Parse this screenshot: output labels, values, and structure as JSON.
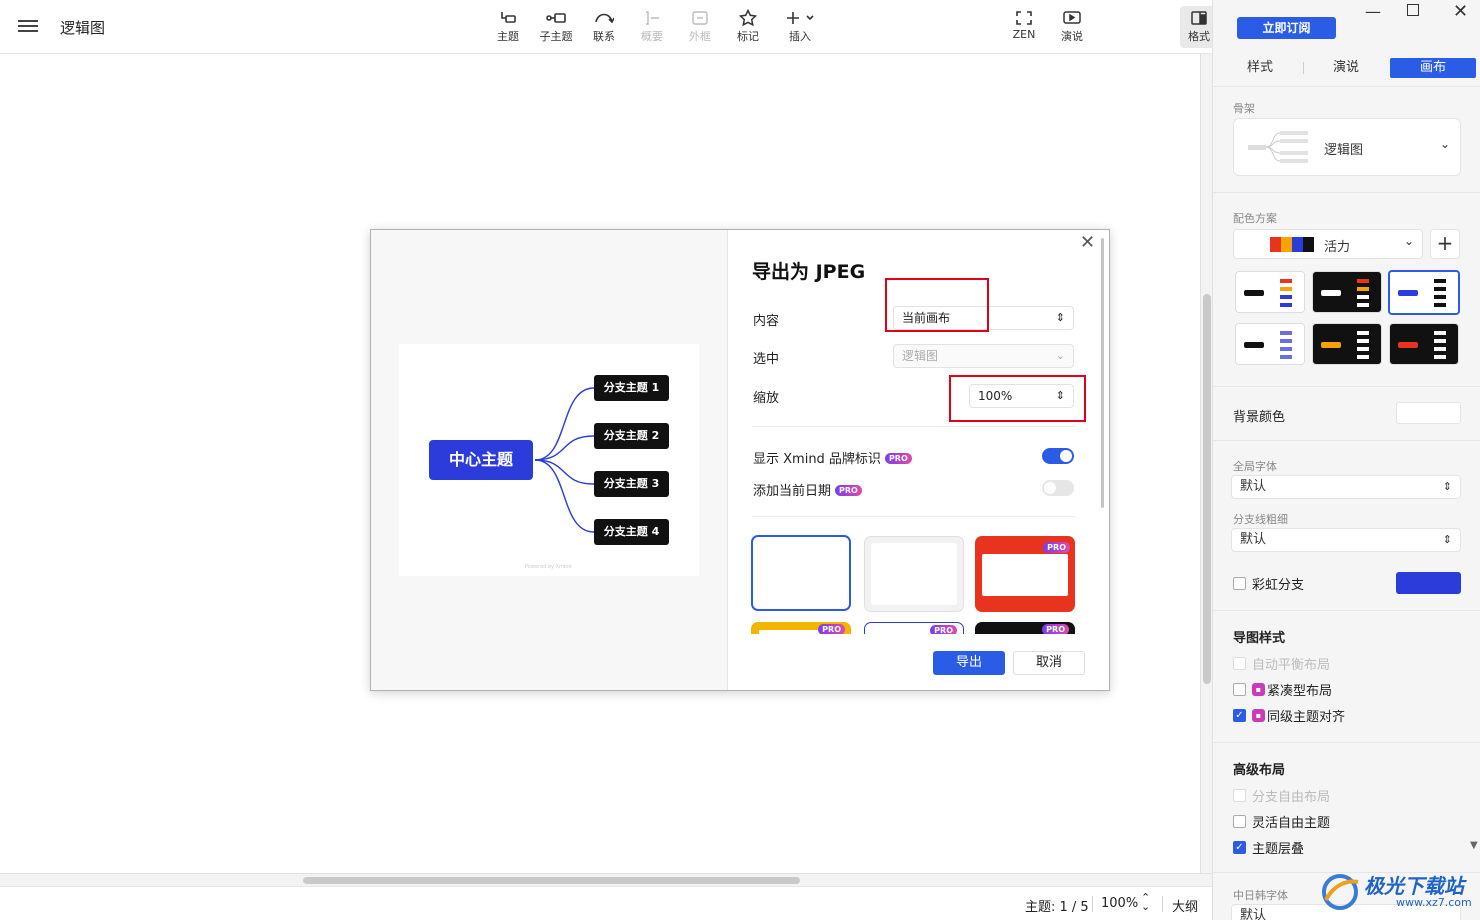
{
  "app": {
    "doc_title": "逻辑图"
  },
  "toolbar": {
    "items": [
      {
        "label": "主题",
        "icon": "topic-icon"
      },
      {
        "label": "子主题",
        "icon": "subtopic-icon"
      },
      {
        "label": "联系",
        "icon": "relationship-icon"
      },
      {
        "label": "概要",
        "icon": "summary-icon",
        "disabled": true
      },
      {
        "label": "外框",
        "icon": "boundary-icon",
        "disabled": true
      },
      {
        "label": "标记",
        "icon": "star-icon"
      },
      {
        "label": "插入",
        "icon": "plus-icon"
      },
      {
        "label": "ZEN",
        "icon": "zen-icon"
      },
      {
        "label": "演说",
        "icon": "pitch-icon"
      },
      {
        "label": "格式",
        "icon": "format-panel-icon",
        "active": true
      }
    ]
  },
  "status": {
    "topics": "主题: 1 / 5",
    "zoom": "100%",
    "outline": "大纲"
  },
  "panel": {
    "subscribe": "立即订阅",
    "tabs": [
      "样式",
      "演说",
      "画布"
    ],
    "active_tab": "画布",
    "skeleton": {
      "title": "骨架",
      "value": "逻辑图"
    },
    "color_scheme": {
      "title": "配色方案",
      "value": "活力",
      "swatches": [
        "#e8331f",
        "#f5a300",
        "#2b3cdb",
        "#111111"
      ],
      "add": "+"
    },
    "bg_color": {
      "label": "背景颜色",
      "value": "#ffffff"
    },
    "global_font": {
      "title": "全局字体",
      "value": "默认"
    },
    "branch_width": {
      "title": "分支线粗细",
      "value": "默认"
    },
    "rainbow": {
      "label": "彩虹分支",
      "color": "#2b3cdb"
    },
    "map_style": {
      "title": "导图样式",
      "options": [
        {
          "label": "自动平衡布局",
          "checked": false,
          "disabled": true,
          "locked": false
        },
        {
          "label": "紧凑型布局",
          "checked": false,
          "disabled": false,
          "locked": true
        },
        {
          "label": "同级主题对齐",
          "checked": true,
          "disabled": false,
          "locked": true
        }
      ]
    },
    "advanced": {
      "title": "高级布局",
      "options": [
        {
          "label": "分支自由布局",
          "checked": false,
          "disabled": true
        },
        {
          "label": "灵活自由主题",
          "checked": false,
          "disabled": false
        },
        {
          "label": "主题层叠",
          "checked": true,
          "disabled": false
        }
      ]
    },
    "cjk_font": {
      "title": "中日韩字体",
      "value": "默认"
    }
  },
  "dialog": {
    "title": "导出为 JPEG",
    "content": {
      "label": "内容",
      "value": "当前画布"
    },
    "selection": {
      "label": "选中",
      "value": "逻辑图"
    },
    "scale": {
      "label": "缩放",
      "value": "100%"
    },
    "show_brand": {
      "label": "显示 Xmind 品牌标识",
      "badge": "PRO",
      "on": true
    },
    "add_date": {
      "label": "添加当前日期",
      "badge": "PRO",
      "on": false
    },
    "bg_pro_badge": "PRO",
    "export": "导出",
    "cancel": "取消",
    "preview": {
      "central": "中心主题",
      "branches": [
        "分支主题 1",
        "分支主题 2",
        "分支主题 3",
        "分支主题 4"
      ],
      "footer": "Powered by Xmind"
    }
  },
  "colors": {
    "accent": "#2b5ce6",
    "highlight": "#e0001a",
    "central": "#2b3cdb"
  },
  "watermark": {
    "text": "极光下载站",
    "url": "www.xz7.com"
  }
}
